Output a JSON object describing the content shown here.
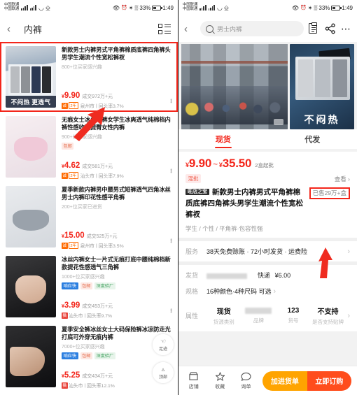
{
  "statusbar": {
    "carrier_line1": "中国联通",
    "carrier_line2": "中国联通",
    "battery": "33%",
    "time": "1:49"
  },
  "left": {
    "search_value": "内裤",
    "back_icon": "chevron-left-icon",
    "layout_icon": "list-layout-icon",
    "fab_scan": "足迹",
    "fab_top": "顶部",
    "products": [
      {
        "title": "新款男士内裤男式平角裤棉质底裤四角裤头男学生潮流个性宽松裤衩",
        "sub": "800+位买家感兴趣",
        "tags": [],
        "price": "9.90",
        "currency": "¥",
        "deal": "成交972万+元",
        "shop_years": "2年",
        "shop_badge": "诚",
        "location": "泉州市",
        "repeat_rate": "回头率3.7%",
        "thumb_caption": "不闷热 更透气",
        "highlighted": true
      },
      {
        "title": "无痕女士冰丝内裤女学生冰爽透气纯棉档内裤性感收腹提臀女性内裤",
        "sub": "900+位买家感兴趣",
        "tags": [
          {
            "text": "包邮",
            "style": "pink"
          }
        ],
        "price": "4.62",
        "currency": "¥",
        "deal": "成交581万+元",
        "shop_years": "2年",
        "shop_badge": "诚",
        "location": "汕头市",
        "repeat_rate": "回头率7.9%",
        "thumb_caption": "",
        "highlighted": false
      },
      {
        "title": "夏季新款内裤男中腰男式短裤透气四角冰丝男士内裤印花性感平角裤",
        "sub": "200+位买家已进货",
        "tags": [],
        "price": "15.00",
        "currency": "¥",
        "deal": "成交525万+元",
        "shop_years": "2年",
        "shop_badge": "诚",
        "location": "泉州市",
        "repeat_rate": "回头率3.5%",
        "thumb_caption": "",
        "highlighted": false
      },
      {
        "title": "冰丝内裤女士一片式无痕打底中腰纯棉档新款提花性感透气三角裤",
        "sub": "1000+位买家感兴趣",
        "tags": [
          {
            "text": "响应快",
            "style": "blue"
          },
          {
            "text": "包邮",
            "style": "pink"
          },
          {
            "text": "深度验厂",
            "style": "green"
          }
        ],
        "price": "3.99",
        "currency": "¥",
        "deal": "成交453万+元",
        "shop_years": "",
        "shop_badge": "猫",
        "location": "汕头市",
        "repeat_rate": "回头率9.7%",
        "thumb_caption": "",
        "highlighted": false
      },
      {
        "title": "夏季安全裤冰丝女士大码保险裤冰凉防走光打底可外穿无痕内裤",
        "sub": "7000+位买家感兴趣",
        "tags": [
          {
            "text": "响应快",
            "style": "blue"
          },
          {
            "text": "包邮",
            "style": "pink"
          },
          {
            "text": "深度验厂",
            "style": "green"
          }
        ],
        "price": "5.25",
        "currency": "¥",
        "deal": "成交434万+元",
        "shop_years": "",
        "shop_badge": "猫",
        "location": "汕头市",
        "repeat_rate": "回头率12.1%",
        "thumb_caption": "",
        "highlighted": false
      }
    ]
  },
  "right": {
    "search_placeholder": "男士内裤",
    "back_icon": "chevron-left-icon",
    "search_icon": "search-icon",
    "clipboard_icon": "clipboard-icon",
    "share_icon": "share-icon",
    "more_icon": "more-dots-icon",
    "gallery": {
      "video_label": "factory-video",
      "right_caption": "不闷热"
    },
    "tabs": [
      {
        "label": "现货",
        "active": true
      },
      {
        "label": "代发",
        "active": false
      }
    ],
    "price": {
      "currency": "¥",
      "min": "9.90",
      "tilde": "~",
      "max": "35.50",
      "moq": "2盒起批"
    },
    "promo_tag": "混批",
    "view_more": "查看",
    "product": {
      "shop_badge": "旺店之宝",
      "title": "新款男士内裤男式平角裤棉质底裤四角裤头男学生潮流个性宽松裤衩",
      "sold": "已售29万+盒",
      "attrs": "学生 / 个性 / 平角裤·包容性强"
    },
    "service": {
      "label": "服务",
      "value": "38天免费赊账 · 72小时发货 · 运费险"
    },
    "shipping": {
      "label": "发货",
      "express": "快递",
      "fee": "¥6.00"
    },
    "spec": {
      "label": "规格",
      "value": "16种颜色·4种尺码 可选"
    },
    "attributes": {
      "label": "属性",
      "columns": [
        {
          "value": "现货",
          "key": "货源类别"
        },
        {
          "value": "",
          "key": "品牌"
        },
        {
          "value": "123",
          "key": "货号"
        },
        {
          "value": "不支持",
          "key": "是否支持贴牌"
        }
      ]
    },
    "bottom": {
      "icons": [
        {
          "label": "店铺",
          "icon": "shop-icon"
        },
        {
          "label": "收藏",
          "icon": "star-icon"
        },
        {
          "label": "询单",
          "icon": "chat-icon"
        }
      ],
      "cta_add": "加进货单",
      "cta_order": "立即订购"
    }
  },
  "colors": {
    "accent_red": "#f3261b",
    "orange": "#ff6a00",
    "cta_orange": "#ffa400",
    "cta_red": "#ff4d1c"
  }
}
